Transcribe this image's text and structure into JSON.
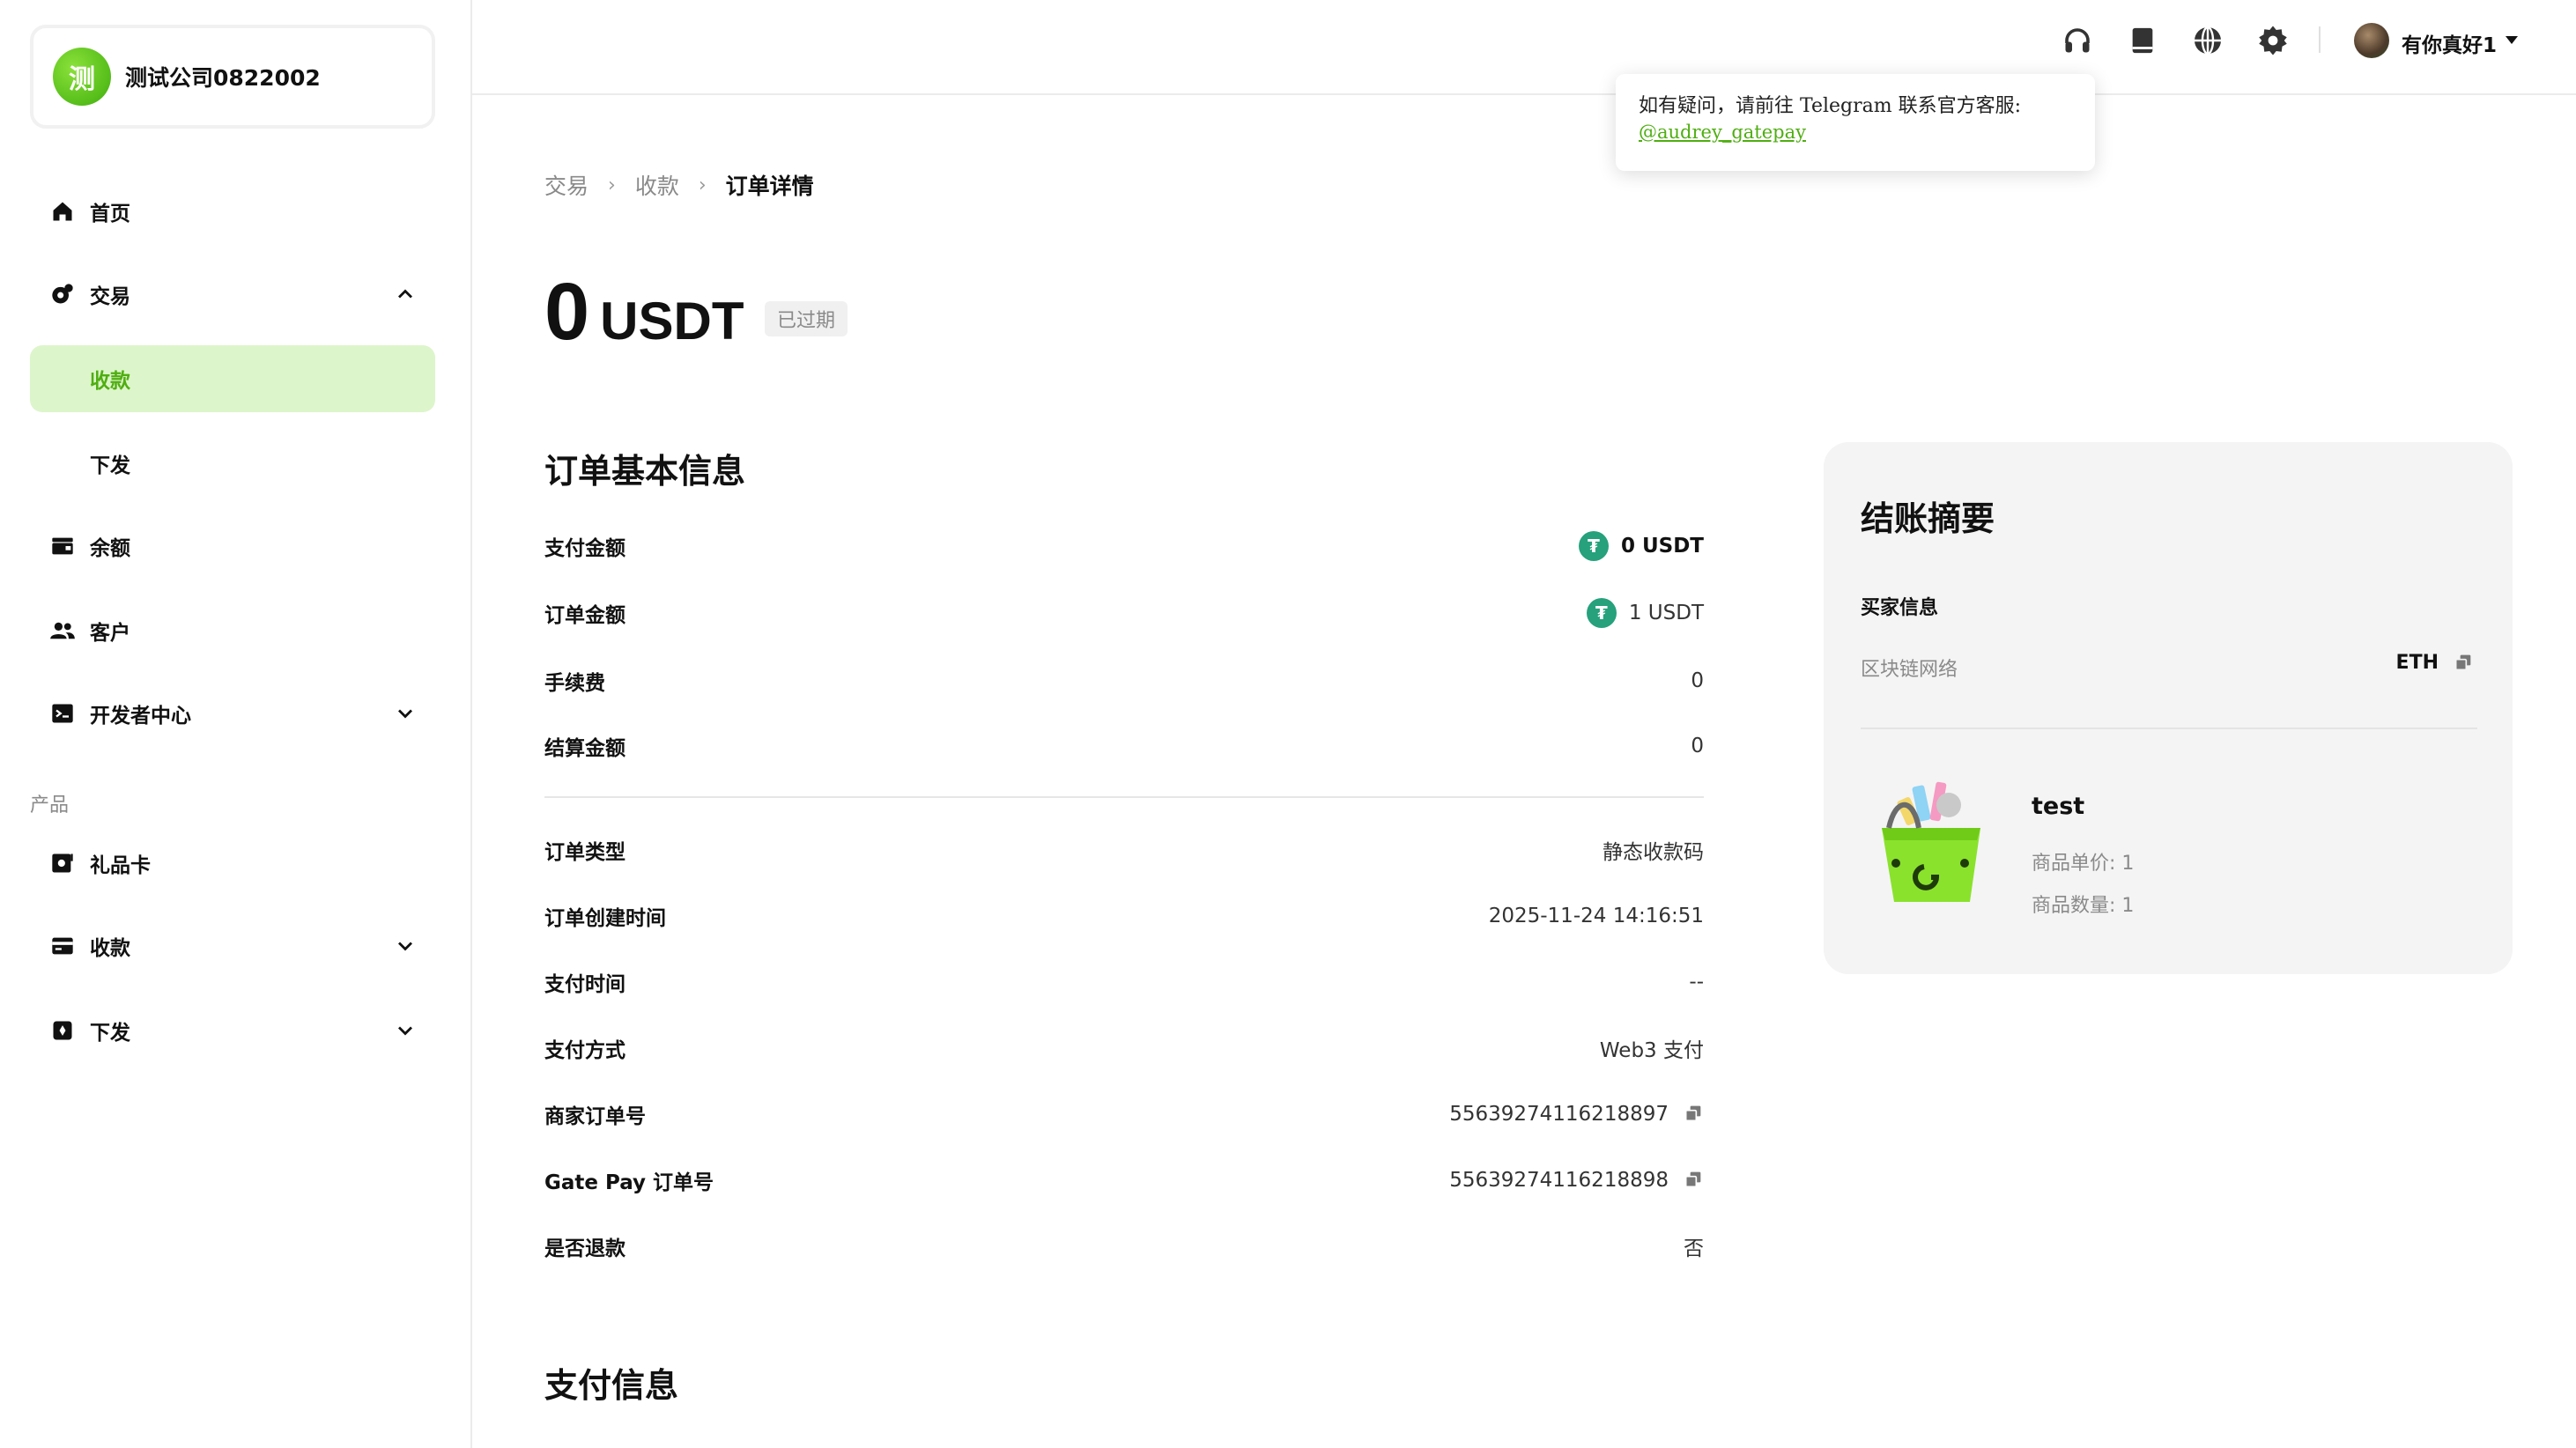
{
  "company": {
    "logo_char": "测",
    "name": "测试公司0822002"
  },
  "sidebar": {
    "items": [
      {
        "label": "首页"
      },
      {
        "label": "交易"
      },
      {
        "label": "收款"
      },
      {
        "label": "下发"
      },
      {
        "label": "余额"
      },
      {
        "label": "客户"
      },
      {
        "label": "开发者中心"
      }
    ],
    "section_label": "产品",
    "product_items": [
      {
        "label": "礼品卡"
      },
      {
        "label": "收款"
      },
      {
        "label": "下发"
      }
    ]
  },
  "topbar": {
    "icons": [
      "headset-icon",
      "book-icon",
      "globe-icon",
      "gear-icon"
    ],
    "username": "有你真好1"
  },
  "tooltip": {
    "text": "如有疑问，请前往 Telegram 联系官方客服:",
    "link": "@audrey_gatepay"
  },
  "breadcrumb": {
    "items": [
      "交易",
      "收款",
      "订单详情"
    ]
  },
  "amount": {
    "value": "0",
    "unit": "USDT",
    "status": "已过期"
  },
  "basic_info": {
    "title": "订单基本信息",
    "rows": [
      {
        "key": "支付金额",
        "value": "0 USDT"
      },
      {
        "key": "订单金额",
        "value": "1 USDT"
      },
      {
        "key": "手续费",
        "value": "0"
      },
      {
        "key": "结算金额",
        "value": "0"
      }
    ],
    "details": [
      {
        "key": "订单类型",
        "value": "静态收款码"
      },
      {
        "key": "订单创建时间",
        "value": "2025-11-24 14:16:51"
      },
      {
        "key": "支付时间",
        "value": "--"
      },
      {
        "key": "支付方式",
        "value": "Web3 支付"
      },
      {
        "key": "商家订单号",
        "value": "55639274116218897"
      },
      {
        "key": "Gate Pay 订单号",
        "value": "55639274116218898"
      },
      {
        "key": "是否退款",
        "value": "否"
      }
    ]
  },
  "payment_info": {
    "title": "支付信息"
  },
  "summary": {
    "title": "结账摘要",
    "buyer_title": "买家信息",
    "network_label": "区块链网络",
    "network_value": "ETH",
    "product": {
      "name": "test",
      "price": "商品单价: 1",
      "qty": "商品数量: 1"
    }
  },
  "colors": {
    "accent": "#4fae11",
    "accent_bg": "#ddf5cb",
    "tether": "#26a17b"
  }
}
